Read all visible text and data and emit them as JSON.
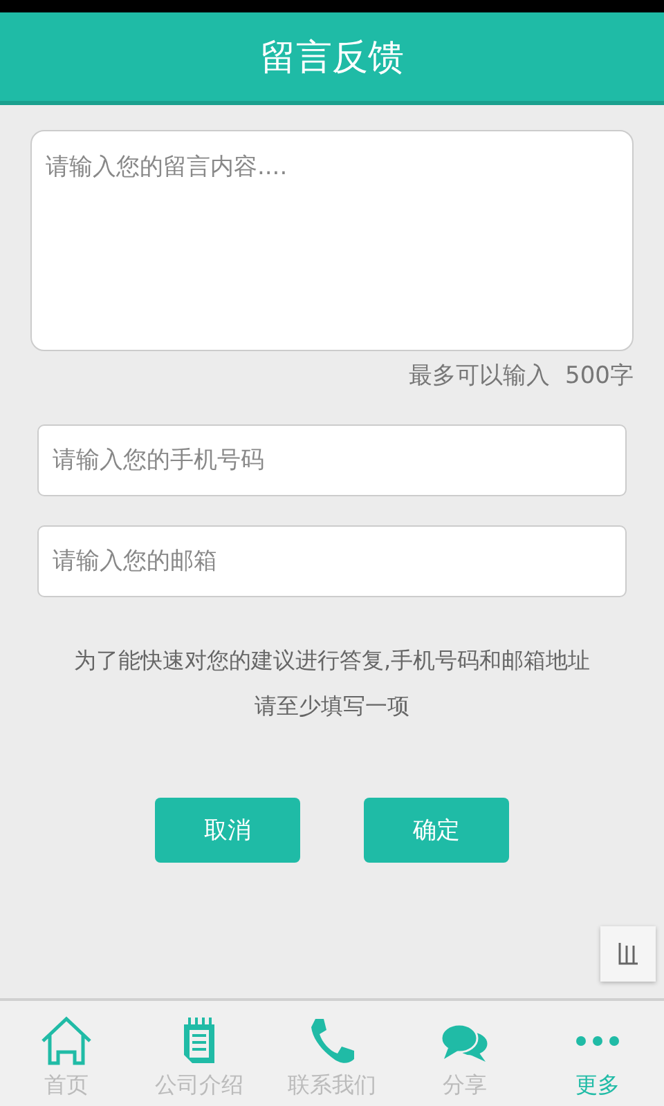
{
  "header": {
    "title": "留言反馈"
  },
  "message": {
    "placeholder": "请输入您的留言内容...."
  },
  "limit_note": "最多可以输入  500字",
  "phone": {
    "placeholder": "请输入您的手机号码"
  },
  "email": {
    "placeholder": "请输入您的邮箱"
  },
  "hint": "为了能快速对您的建议进行答复,手机号码和邮箱地址请至少填写一项",
  "buttons": [
    "取消",
    "确定"
  ],
  "nav": [
    {
      "label": "首页",
      "selected": false
    },
    {
      "label": "公司介绍",
      "selected": false
    },
    {
      "label": "联系我们",
      "selected": false
    },
    {
      "label": "分享",
      "selected": false
    },
    {
      "label": "更多",
      "selected": true
    }
  ]
}
